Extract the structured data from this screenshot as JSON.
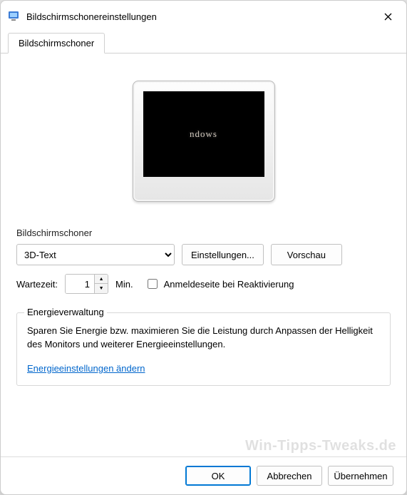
{
  "window": {
    "title": "Bildschirmschonereinstellungen"
  },
  "tab": {
    "label": "Bildschirmschoner"
  },
  "preview": {
    "text": "ndows"
  },
  "screensaver": {
    "label": "Bildschirmschoner",
    "selected": "3D-Text",
    "settings_button": "Einstellungen...",
    "preview_button": "Vorschau"
  },
  "wait": {
    "label": "Wartezeit:",
    "value": "1",
    "unit": "Min.",
    "checkbox_label": "Anmeldeseite bei Reaktivierung"
  },
  "energy": {
    "legend": "Energieverwaltung",
    "text": "Sparen Sie Energie bzw. maximieren Sie die Leistung durch Anpassen der Helligkeit des Monitors und weiterer Energieeinstellungen.",
    "link": "Energieeinstellungen ändern"
  },
  "buttons": {
    "ok": "OK",
    "cancel": "Abbrechen",
    "apply": "Übernehmen"
  },
  "watermark": "Win-Tipps-Tweaks.de"
}
